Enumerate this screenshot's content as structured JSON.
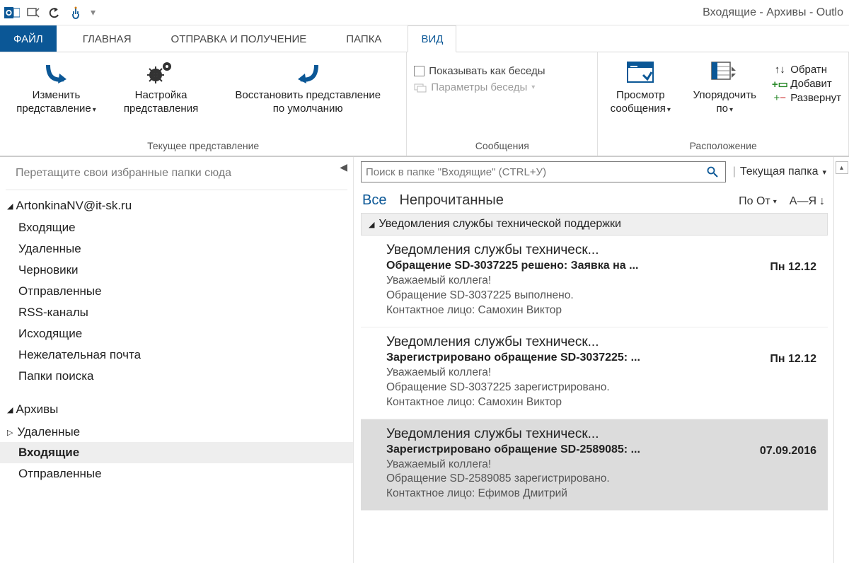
{
  "window_title": "Входящие - Архивы - Outlo",
  "tabs": {
    "file": "ФАЙЛ",
    "home": "ГЛАВНАЯ",
    "sendreceive": "ОТПРАВКА И ПОЛУЧЕНИЕ",
    "folder": "ПАПКА",
    "view": "ВИД"
  },
  "ribbon": {
    "group_current_view": {
      "label": "Текущее представление",
      "change_view_l1": "Изменить",
      "change_view_l2": "представление",
      "view_settings_l1": "Настройка",
      "view_settings_l2": "представления",
      "reset_view_l1": "Восстановить представление",
      "reset_view_l2": "по умолчанию"
    },
    "group_messages": {
      "label": "Сообщения",
      "show_as_conv": "Показывать как беседы",
      "conv_settings": "Параметры беседы"
    },
    "group_layout": {
      "label": "Расположение",
      "msg_preview_l1": "Просмотр",
      "msg_preview_l2": "сообщения",
      "arrange_l1": "Упорядочить",
      "arrange_l2": "по",
      "reverse": "Обратн",
      "add": "Добавит",
      "expand": "Развернут"
    }
  },
  "nav": {
    "fav_hint": "Перетащите свои избранные папки сюда",
    "account": "ArtonkinaNV@it-sk.ru",
    "folders": [
      "Входящие",
      "Удаленные",
      "Черновики",
      "Отправленные",
      "RSS-каналы",
      "Исходящие",
      "Нежелательная почта",
      "Папки поиска"
    ],
    "archives": {
      "label": "Архивы",
      "deleted": "Удаленные",
      "inbox": "Входящие",
      "sent": "Отправленные"
    }
  },
  "search": {
    "placeholder": "Поиск в папке \"Входящие\" (CTRL+У)",
    "scope": "Текущая папка"
  },
  "filters": {
    "all": "Все",
    "unread": "Непрочитанные",
    "sort_by": "По От",
    "sort_dir": "А—Я"
  },
  "group_header": "Уведомления службы технической поддержки",
  "messages": [
    {
      "from": "Уведомления службы техническ...",
      "subject": "Обращение SD-3037225 решено: Заявка на ...",
      "date": "Пн 12.12",
      "preview": "Уважаемый коллега!\nОбращение SD-3037225 выполнено.\nКонтактное лицо: Самохин Виктор",
      "selected": false
    },
    {
      "from": "Уведомления службы техническ...",
      "subject": "Зарегистрировано обращение SD-3037225: ...",
      "date": "Пн 12.12",
      "preview": "Уважаемый коллега!\nОбращение SD-3037225 зарегистрировано.\nКонтактное лицо: Самохин Виктор",
      "selected": false
    },
    {
      "from": "Уведомления службы техническ...",
      "subject": "Зарегистрировано обращение SD-2589085: ...",
      "date": "07.09.2016",
      "preview": "Уважаемый коллега!\nОбращение SD-2589085 зарегистрировано.\nКонтактное лицо: Ефимов Дмитрий",
      "selected": true
    }
  ]
}
